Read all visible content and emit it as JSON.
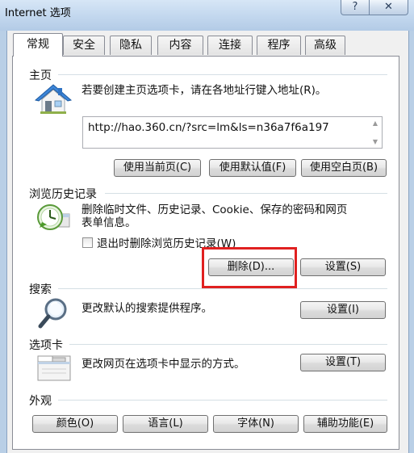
{
  "window": {
    "title": "Internet 选项",
    "help_glyph": "?",
    "close_glyph": "✕"
  },
  "tabs": [
    {
      "label": "常规",
      "active": true
    },
    {
      "label": "安全"
    },
    {
      "label": "隐私"
    },
    {
      "label": "内容"
    },
    {
      "label": "连接"
    },
    {
      "label": "程序"
    },
    {
      "label": "高级"
    }
  ],
  "homepage": {
    "label": "主页",
    "icon": "house-icon",
    "description": "若要创建主页选项卡，请在各地址行键入地址(R)。",
    "url": "http://hao.360.cn/?src=lm&ls=n36a7f6a197",
    "buttons": [
      "使用当前页(C)",
      "使用默认值(F)",
      "使用空白页(B)"
    ]
  },
  "history": {
    "label": "浏览历史记录",
    "icon": "history-clock-icon",
    "description_line1": "删除临时文件、历史记录、Cookie、保存的密码和网页",
    "description_line2": "表单信息。",
    "checkbox_label": "退出时删除浏览历史记录(W)",
    "delete_button": "删除(D)...",
    "settings_button": "设置(S)"
  },
  "search": {
    "label": "搜索",
    "icon": "magnifier-icon",
    "description": "更改默认的搜索提供程序。",
    "settings_button": "设置(I)"
  },
  "tabs_section": {
    "label": "选项卡",
    "icon": "tabs-window-icon",
    "description": "更改网页在选项卡中显示的方式。",
    "settings_button": "设置(T)"
  },
  "appearance": {
    "label": "外观",
    "buttons": [
      "颜色(O)",
      "语言(L)",
      "字体(N)",
      "辅助功能(E)"
    ]
  },
  "colors": {
    "highlight": "#e02020",
    "titlebar": "#c2d7ee"
  }
}
